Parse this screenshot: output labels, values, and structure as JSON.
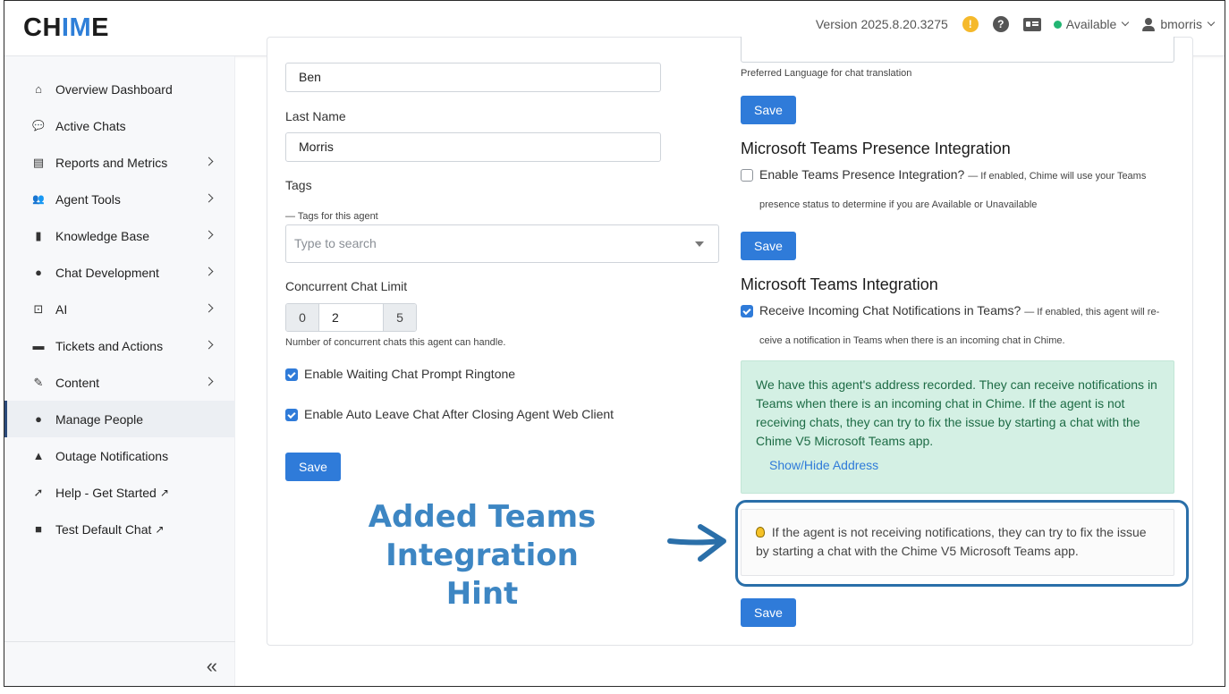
{
  "header": {
    "logo": {
      "part1": "CH",
      "part2": "IM",
      "part3": "E"
    },
    "version": "Version 2025.8.20.3275",
    "warning_icon_glyph": "!",
    "help_icon_glyph": "?",
    "status": "Available",
    "username": "bmorris"
  },
  "sidebar": {
    "items": [
      {
        "label": "Overview Dashboard",
        "icon": "home-icon",
        "glyph": "⌂"
      },
      {
        "label": "Active Chats",
        "icon": "chats-icon",
        "glyph": "💬"
      },
      {
        "label": "Reports and Metrics",
        "icon": "chart-icon",
        "glyph": "▤"
      },
      {
        "label": "Agent Tools",
        "icon": "users-icon",
        "glyph": "👥"
      },
      {
        "label": "Knowledge Base",
        "icon": "book-icon",
        "glyph": "▮"
      },
      {
        "label": "Chat Development",
        "icon": "comment-icon",
        "glyph": "●"
      },
      {
        "label": "AI",
        "icon": "robot-icon",
        "glyph": "⊡"
      },
      {
        "label": "Tickets and Actions",
        "icon": "ticket-icon",
        "glyph": "▬"
      },
      {
        "label": "Content",
        "icon": "edit-icon",
        "glyph": "✎"
      },
      {
        "label": "Manage People",
        "icon": "user-icon",
        "glyph": "●"
      },
      {
        "label": "Outage Notifications",
        "icon": "alert-icon",
        "glyph": "▲"
      },
      {
        "label": "Help - Get Started",
        "icon": "rocket-icon",
        "glyph": "➚",
        "external": "↗"
      },
      {
        "label": "Test Default Chat",
        "icon": "message-icon",
        "glyph": "■",
        "external": "↗"
      }
    ],
    "collapse_glyph": "«"
  },
  "form_left": {
    "first_name_value": "Ben",
    "last_name_label": "Last Name",
    "last_name_value": "Morris",
    "tags_label": "Tags",
    "tags_hint": "— Tags for this agent",
    "tags_placeholder": "Type to search",
    "concurrent_label": "Concurrent Chat Limit",
    "stepper_min": "0",
    "stepper_value": "2",
    "stepper_max": "5",
    "concurrent_hint": "Number of concurrent chats this agent can handle.",
    "ringtone_label": "Enable Waiting Chat Prompt Ringtone",
    "auto_leave_label": "Enable Auto Leave Chat After Closing Agent Web Client",
    "save_label": "Save"
  },
  "form_right": {
    "preferred_language_hint": "Preferred Language for chat translation",
    "save_label": "Save",
    "presence_title": "Microsoft Teams Presence Integration",
    "presence_checkbox_label": "Enable Teams Presence Integration?",
    "presence_hint_line1": "— If enabled, Chime will use your Teams",
    "presence_hint_line2": "presence status to determine if you are Available or Unavailable",
    "teams_title": "Microsoft Teams Integration",
    "teams_checkbox_label": "Receive Incoming Chat Notifications in Teams?",
    "teams_hint_line1": "— If enabled, this agent will re-",
    "teams_hint_line2": "ceive a notification in Teams when there is an incoming chat in Chime.",
    "green_message": "We have this agent's address recorded. They can receive notifications in Teams when there is an incoming chat in Chime. If the agent is not receiving chats, they can try to fix the issue by starting a chat with the Chime V5 Microsoft Teams app.",
    "show_hide_link": "Show/Hide Address",
    "hint_text": "If the agent is not receiving notifications, they can try to fix the issue by starting a chat with the Chime V5 Microsoft Teams app."
  },
  "annotation": {
    "line1": "Added Teams Integration",
    "line2": "Hint",
    "color": "#3d86c3"
  },
  "colors": {
    "primary": "#2f7bd9",
    "success_bg": "#d4f0e4",
    "success_text": "#1d6b45",
    "status_green": "#22b573",
    "warning": "#f5b92b"
  }
}
